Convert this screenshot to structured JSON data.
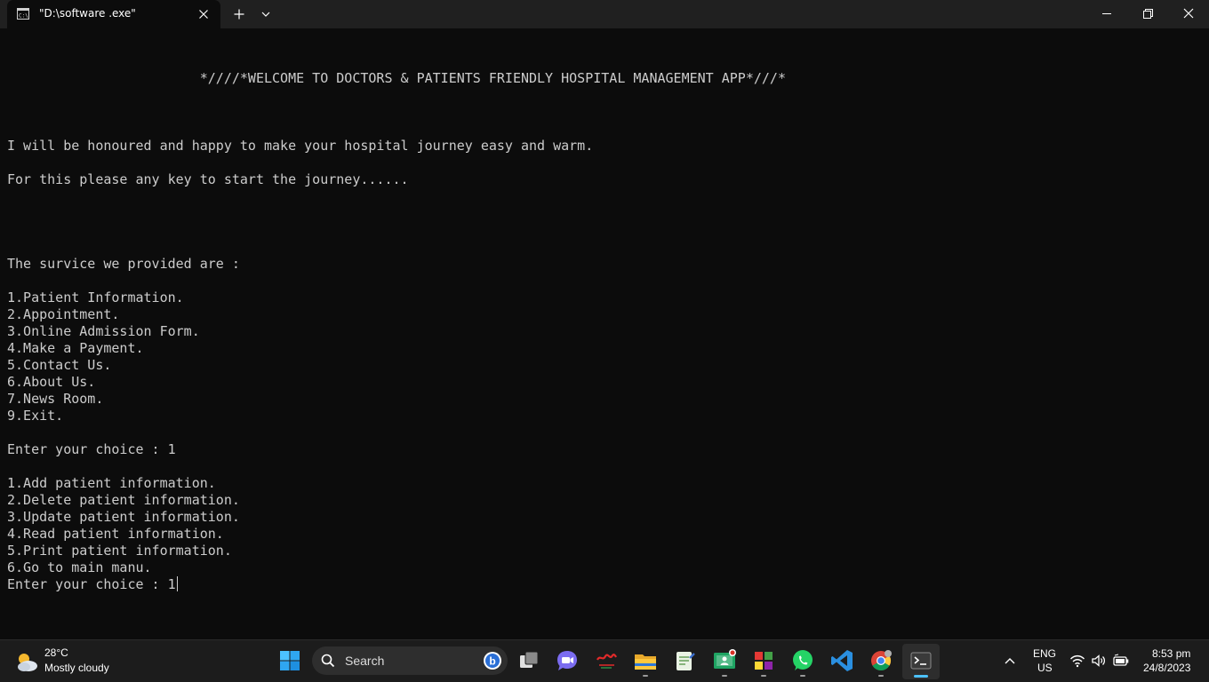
{
  "window": {
    "tab_title": "\"D:\\software .exe\"",
    "tab_icon": "console-icon"
  },
  "console": {
    "lines": [
      "                        *////*WELCOME TO DOCTORS & PATIENTS FRIENDLY HOSPITAL MANAGEMENT APP*///*",
      "",
      "",
      "",
      "I will be honoured and happy to make your hospital journey easy and warm.",
      "",
      "For this please any key to start the journey......",
      "",
      "",
      "",
      "",
      "The survice we provided are :",
      "",
      "1.Patient Information.",
      "2.Appointment.",
      "3.Online Admission Form.",
      "4.Make a Payment.",
      "5.Contact Us.",
      "6.About Us.",
      "7.News Room.",
      "9.Exit.",
      "",
      "Enter your choice : 1",
      "",
      "1.Add patient information.",
      "2.Delete patient information.",
      "3.Update patient information.",
      "4.Read patient information.",
      "5.Print patient information.",
      "6.Go to main manu.",
      "Enter your choice : 1"
    ]
  },
  "taskbar": {
    "weather": {
      "temp": "28°C",
      "desc": "Mostly cloudy",
      "icon": "partly-cloudy-icon"
    },
    "search_placeholder": "Search",
    "tray": {
      "lang_line1": "ENG",
      "lang_line2": "US"
    },
    "clock": {
      "time": "8:53 pm",
      "date": "24/8/2023"
    }
  },
  "colors": {
    "console_bg": "#0c0c0c",
    "console_fg": "#cccccc",
    "titlebar_bg": "#202020",
    "taskbar_bg": "#1c1c1c",
    "accent": "#4cc2ff"
  }
}
